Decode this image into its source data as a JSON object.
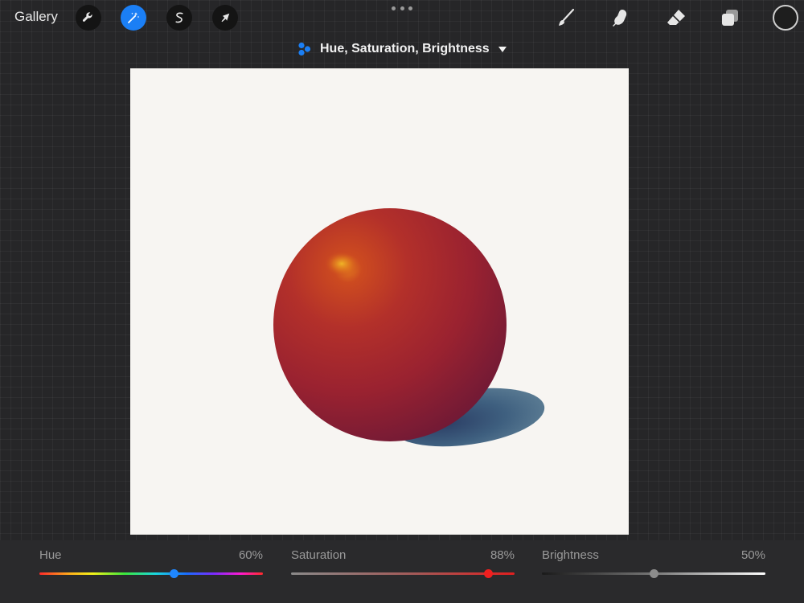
{
  "toolbar": {
    "gallery_label": "Gallery",
    "left_tools": [
      {
        "name": "actions",
        "icon": "wrench-icon"
      },
      {
        "name": "adjustments",
        "icon": "magic-wand-icon",
        "active": true
      },
      {
        "name": "selection",
        "icon": "selection-s-icon"
      },
      {
        "name": "transform",
        "icon": "arrow-cursor-icon"
      }
    ],
    "right_tools": [
      {
        "name": "brush",
        "icon": "brush-icon"
      },
      {
        "name": "smudge",
        "icon": "smudge-finger-icon"
      },
      {
        "name": "eraser",
        "icon": "eraser-icon"
      },
      {
        "name": "layers",
        "icon": "layers-icon"
      }
    ],
    "color": "#1e1e1e"
  },
  "adjustment": {
    "title": "Hue, Saturation, Brightness",
    "icon": "adjustment-dots-icon",
    "accent_color": "#1b7ff5"
  },
  "canvas": {
    "subject": "red-sphere-with-shadow",
    "background_color": "#f7f5f2",
    "sphere_color": "#b3302a",
    "shadow_color": "#3e5f7f"
  },
  "sliders": [
    {
      "name": "Hue",
      "value_text": "60%",
      "value": 0.6
    },
    {
      "name": "Saturation",
      "value_text": "88%",
      "value": 0.88
    },
    {
      "name": "Brightness",
      "value_text": "50%",
      "value": 0.5
    }
  ]
}
